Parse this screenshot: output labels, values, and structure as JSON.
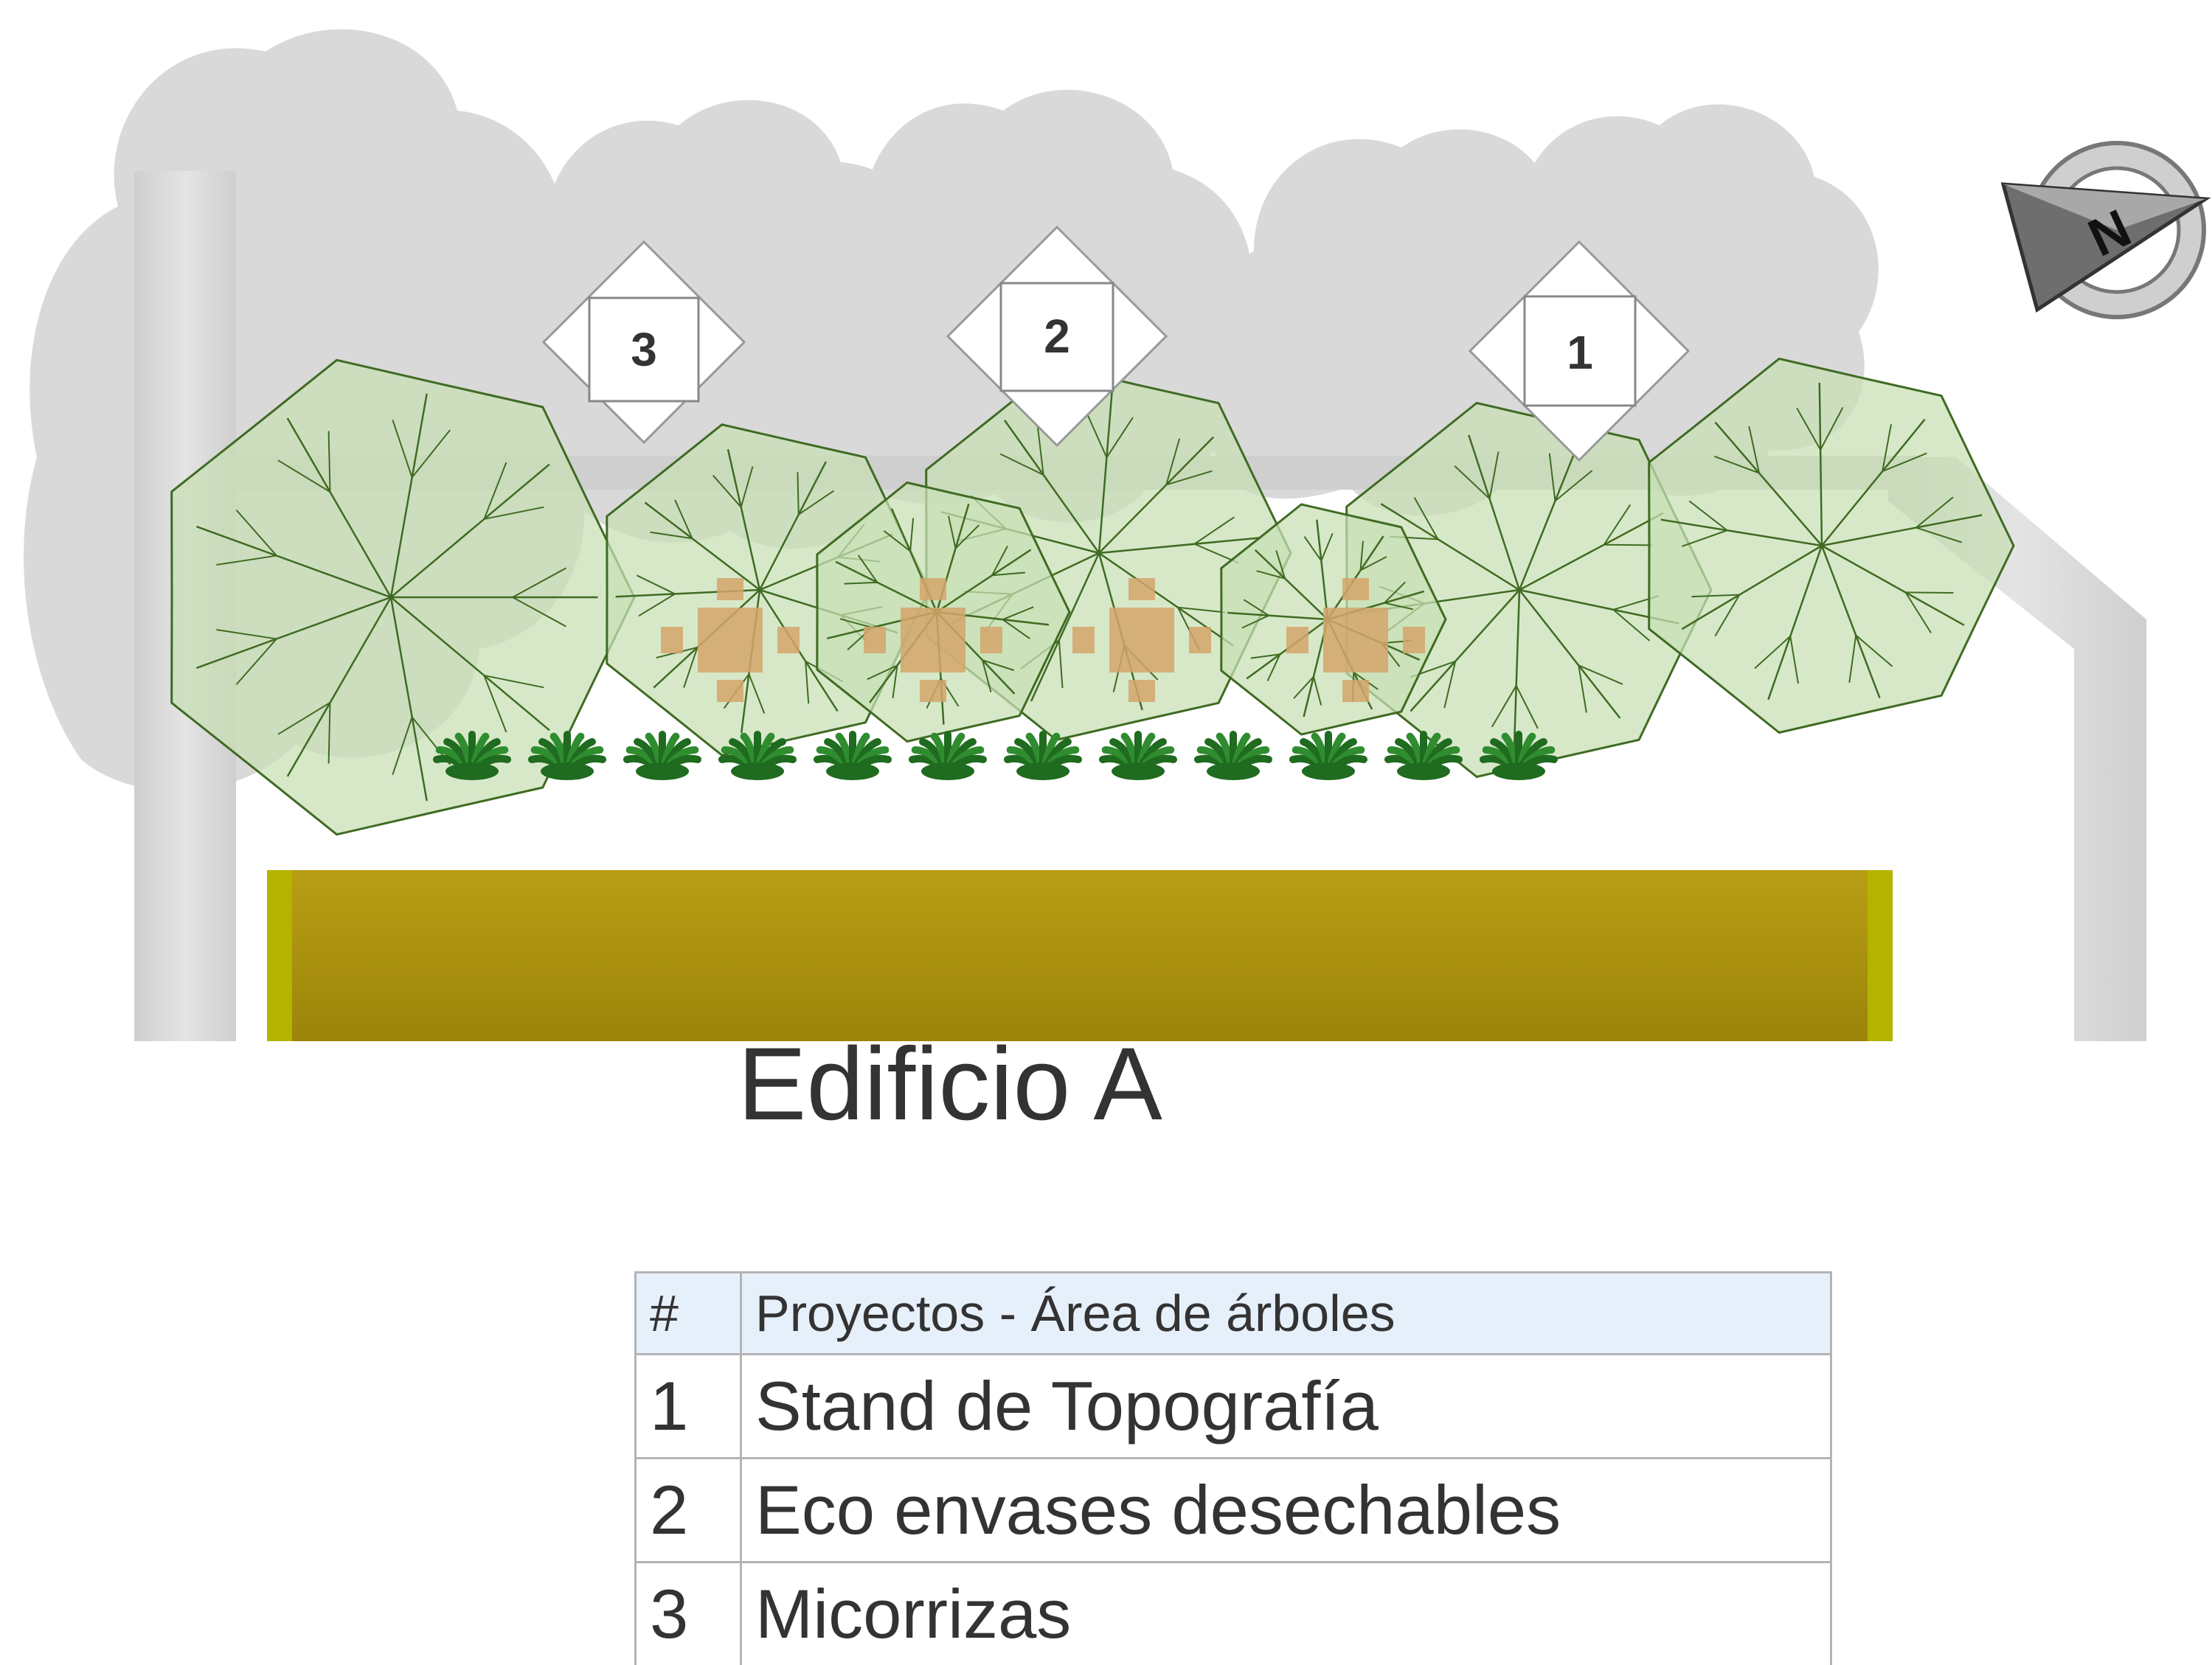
{
  "diagram": {
    "markers": [
      {
        "id": "3",
        "label": "3"
      },
      {
        "id": "2",
        "label": "2"
      },
      {
        "id": "1",
        "label": "1"
      }
    ],
    "compass": {
      "label": "N"
    },
    "building": {
      "label": "Edificio A",
      "color": "#a8900c"
    },
    "colors": {
      "canopy": "#c8dfb4",
      "canopy_stroke": "#3f6b22",
      "shadow": "#d9d9d9",
      "path": "#d6d6d6",
      "furniture": "#d4a56a",
      "shrub": "#2f8c2f"
    }
  },
  "legend": {
    "header": {
      "num": "#",
      "title": "Proyectos - Área de árboles"
    },
    "rows": [
      {
        "num": "1",
        "name": "Stand de Topografía"
      },
      {
        "num": "2",
        "name": "Eco envases desechables"
      },
      {
        "num": "3",
        "name": "Micorrizas"
      }
    ]
  }
}
